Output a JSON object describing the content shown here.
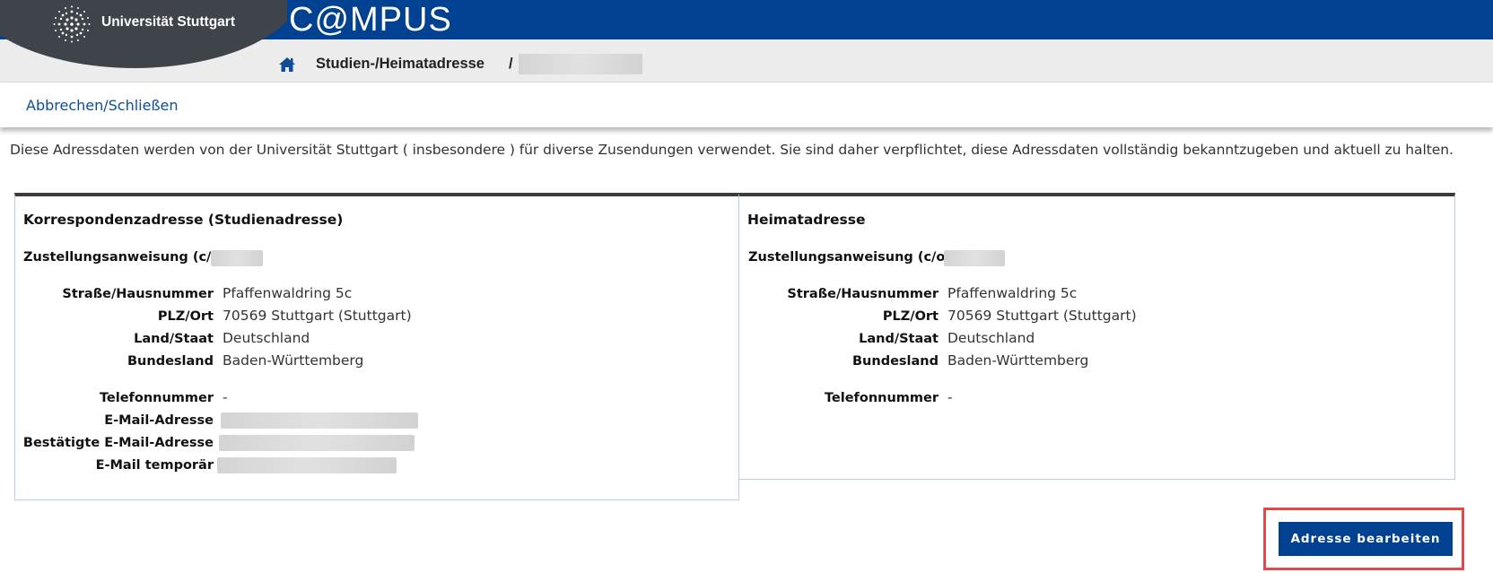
{
  "header": {
    "logo_text": "Universität Stuttgart",
    "app_title": "C@MPUS",
    "logo_icon": "university-seal-icon",
    "brand_color": "#004191"
  },
  "breadcrumb": {
    "home_icon": "home-icon",
    "page": "Studien-/Heimatadresse",
    "separator": "/"
  },
  "actions": {
    "cancel_label": "Abbrechen/Schließen"
  },
  "info_text": "Diese Adressdaten werden von der Universität Stuttgart ( insbesondere ) für diverse Zusendungen verwendet. Sie sind daher verpflichtet, diese Adressdaten vollständig bekanntzugeben und aktuell zu halten.",
  "correspondence": {
    "title": "Korrespondenzadresse (Studienadresse)",
    "co_label": "Zustellungsanweisung (c/o)",
    "street_label": "Straße/Hausnummer",
    "street": "Pfaffenwaldring 5c",
    "zip_city_label": "PLZ/Ort",
    "zip_city": "70569 Stuttgart (Stuttgart)",
    "country_label": "Land/Staat",
    "country": "Deutschland",
    "state_label": "Bundesland",
    "state": "Baden-Württemberg",
    "phone_label": "Telefonnummer",
    "phone": "-",
    "email_label": "E-Mail-Adresse",
    "confirmed_email_label": "Bestätigte E-Mail-Adresse",
    "temp_email_label": "E-Mail temporär"
  },
  "home": {
    "title": "Heimatadresse",
    "co_label": "Zustellungsanweisung (c/o)",
    "street_label": "Straße/Hausnummer",
    "street": "Pfaffenwaldring 5c",
    "zip_city_label": "PLZ/Ort",
    "zip_city": "70569 Stuttgart (Stuttgart)",
    "country_label": "Land/Staat",
    "country": "Deutschland",
    "state_label": "Bundesland",
    "state": "Baden-Württemberg",
    "phone_label": "Telefonnummer",
    "phone": "-"
  },
  "edit_button_label": "Adresse bearbeiten",
  "highlight_color": "#e04a4a"
}
